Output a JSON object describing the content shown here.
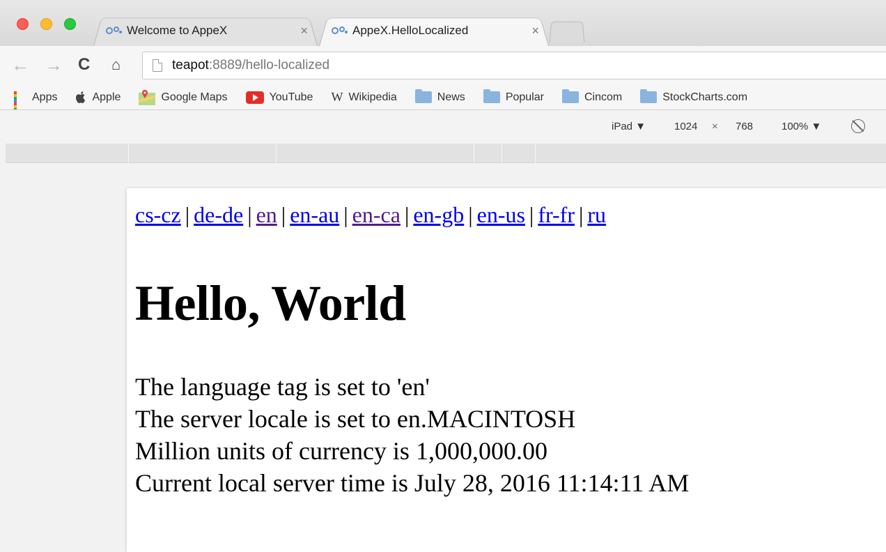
{
  "browser": {
    "tabs": [
      {
        "title": "Welcome to AppeX",
        "active": false
      },
      {
        "title": "AppeX.HelloLocalized",
        "active": true
      }
    ],
    "tab_close_glyph": "×",
    "url_host": "teapot",
    "url_rest": ":8889/hello-localized",
    "bookmarks": [
      {
        "label": "Apps",
        "icon": "apps-grid-icon"
      },
      {
        "label": "Apple",
        "icon": "apple-icon"
      },
      {
        "label": "Google Maps",
        "icon": "google-maps-icon"
      },
      {
        "label": "YouTube",
        "icon": "youtube-icon"
      },
      {
        "label": "Wikipedia",
        "icon": "wikipedia-icon"
      },
      {
        "label": "News",
        "icon": "folder-icon"
      },
      {
        "label": "Popular",
        "icon": "folder-icon"
      },
      {
        "label": "Cincom",
        "icon": "folder-icon"
      },
      {
        "label": "StockCharts.com",
        "icon": "folder-icon"
      }
    ],
    "device_toolbar": {
      "device": "iPad ▼",
      "width": "1024",
      "times": "×",
      "height": "768",
      "zoom": "100% ▼"
    }
  },
  "page": {
    "locales": [
      {
        "label": "cs-cz",
        "visited": false
      },
      {
        "label": "de-de",
        "visited": false
      },
      {
        "label": "en",
        "visited": true
      },
      {
        "label": "en-au",
        "visited": false
      },
      {
        "label": "en-ca",
        "visited": true
      },
      {
        "label": "en-gb",
        "visited": false
      },
      {
        "label": "en-us",
        "visited": false
      },
      {
        "label": "fr-fr",
        "visited": false
      },
      {
        "label": "ru",
        "visited": false
      }
    ],
    "separator": "|",
    "heading": "Hello, World",
    "lines": [
      "The language tag is set to 'en'",
      "The server locale is set to en.MACINTOSH",
      "Million units of currency is 1,000,000.00",
      "Current local server time is July 28, 2016 11:14:11 AM"
    ]
  },
  "colors": {
    "link": "#0000ee",
    "visited_link": "#551a8b",
    "close_red": "#fc5f57",
    "minimize_yellow": "#fdbc2e",
    "zoom_green": "#28c840"
  }
}
